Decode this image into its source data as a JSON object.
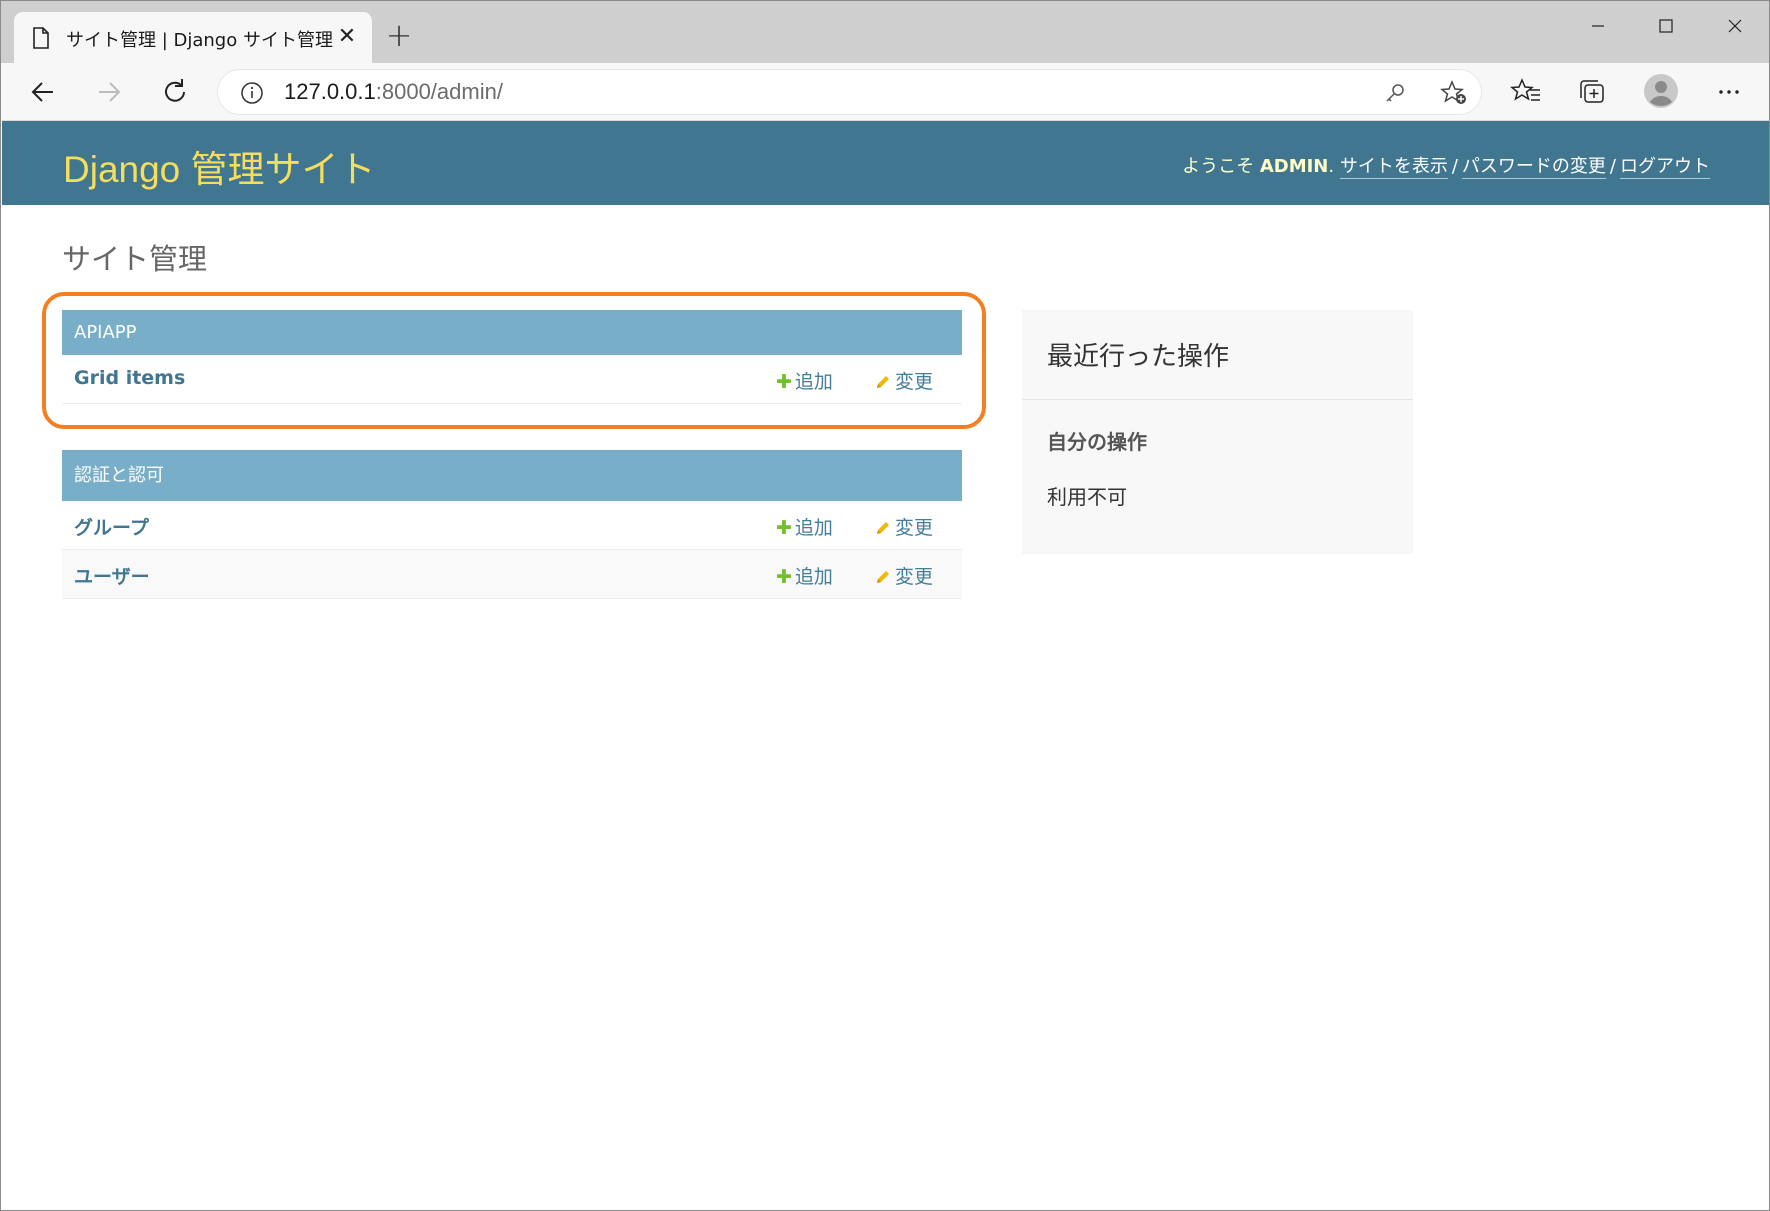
{
  "browser": {
    "tab_title": "サイト管理 | Django サイト管理",
    "tab_close": "✕",
    "new_tab": "+",
    "url_host": "127.0.0.1",
    "url_rest": ":8000/admin/"
  },
  "header": {
    "branding": "Django 管理サイト",
    "welcome": "ようこそ",
    "username": "ADMIN",
    "after_username": ".",
    "view_site": "サイトを表示",
    "change_password": "パスワードの変更",
    "logout": "ログアウト",
    "separator": "/"
  },
  "content": {
    "title": "サイト管理",
    "modules": [
      {
        "caption": "APIAPP",
        "models": [
          {
            "name": "Grid items",
            "add": "追加",
            "change": "変更"
          }
        ]
      },
      {
        "caption": "認証と認可",
        "models": [
          {
            "name": "グループ",
            "add": "追加",
            "change": "変更"
          },
          {
            "name": "ユーザー",
            "add": "追加",
            "change": "変更"
          }
        ]
      }
    ]
  },
  "sidebar": {
    "recent_title": "最近行った操作",
    "my_actions": "自分の操作",
    "none_available": "利用不可"
  },
  "icons": {
    "plus": "✚"
  },
  "colors": {
    "header_bg": "#417690",
    "branding": "#f5dd5d",
    "module_caption_bg": "#79aec8",
    "link": "#447e9b",
    "add_icon": "#70bf2b",
    "change_icon": "#efb80b",
    "highlight": "#f57f20"
  }
}
